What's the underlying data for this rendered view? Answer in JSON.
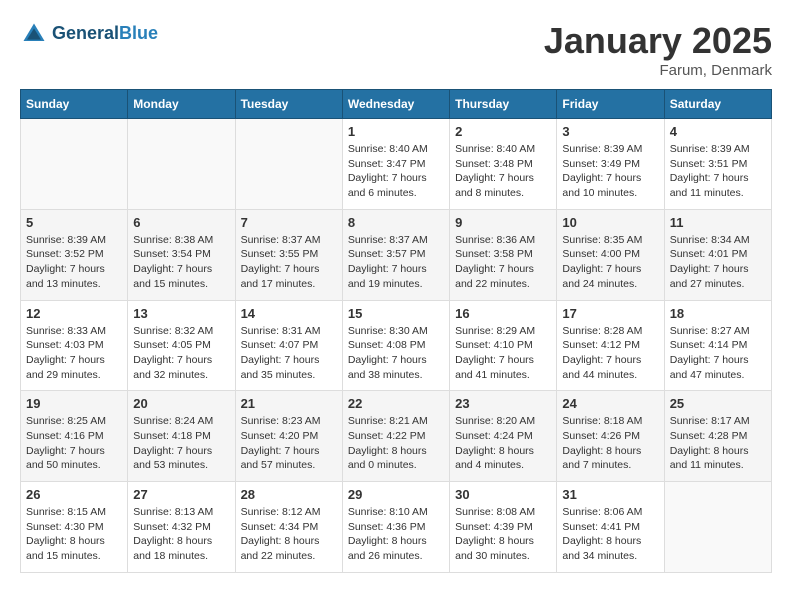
{
  "header": {
    "logo_line1": "General",
    "logo_line2": "Blue",
    "month": "January 2025",
    "location": "Farum, Denmark"
  },
  "weekdays": [
    "Sunday",
    "Monday",
    "Tuesday",
    "Wednesday",
    "Thursday",
    "Friday",
    "Saturday"
  ],
  "weeks": [
    [
      {
        "day": "",
        "info": ""
      },
      {
        "day": "",
        "info": ""
      },
      {
        "day": "",
        "info": ""
      },
      {
        "day": "1",
        "info": "Sunrise: 8:40 AM\nSunset: 3:47 PM\nDaylight: 7 hours\nand 6 minutes."
      },
      {
        "day": "2",
        "info": "Sunrise: 8:40 AM\nSunset: 3:48 PM\nDaylight: 7 hours\nand 8 minutes."
      },
      {
        "day": "3",
        "info": "Sunrise: 8:39 AM\nSunset: 3:49 PM\nDaylight: 7 hours\nand 10 minutes."
      },
      {
        "day": "4",
        "info": "Sunrise: 8:39 AM\nSunset: 3:51 PM\nDaylight: 7 hours\nand 11 minutes."
      }
    ],
    [
      {
        "day": "5",
        "info": "Sunrise: 8:39 AM\nSunset: 3:52 PM\nDaylight: 7 hours\nand 13 minutes."
      },
      {
        "day": "6",
        "info": "Sunrise: 8:38 AM\nSunset: 3:54 PM\nDaylight: 7 hours\nand 15 minutes."
      },
      {
        "day": "7",
        "info": "Sunrise: 8:37 AM\nSunset: 3:55 PM\nDaylight: 7 hours\nand 17 minutes."
      },
      {
        "day": "8",
        "info": "Sunrise: 8:37 AM\nSunset: 3:57 PM\nDaylight: 7 hours\nand 19 minutes."
      },
      {
        "day": "9",
        "info": "Sunrise: 8:36 AM\nSunset: 3:58 PM\nDaylight: 7 hours\nand 22 minutes."
      },
      {
        "day": "10",
        "info": "Sunrise: 8:35 AM\nSunset: 4:00 PM\nDaylight: 7 hours\nand 24 minutes."
      },
      {
        "day": "11",
        "info": "Sunrise: 8:34 AM\nSunset: 4:01 PM\nDaylight: 7 hours\nand 27 minutes."
      }
    ],
    [
      {
        "day": "12",
        "info": "Sunrise: 8:33 AM\nSunset: 4:03 PM\nDaylight: 7 hours\nand 29 minutes."
      },
      {
        "day": "13",
        "info": "Sunrise: 8:32 AM\nSunset: 4:05 PM\nDaylight: 7 hours\nand 32 minutes."
      },
      {
        "day": "14",
        "info": "Sunrise: 8:31 AM\nSunset: 4:07 PM\nDaylight: 7 hours\nand 35 minutes."
      },
      {
        "day": "15",
        "info": "Sunrise: 8:30 AM\nSunset: 4:08 PM\nDaylight: 7 hours\nand 38 minutes."
      },
      {
        "day": "16",
        "info": "Sunrise: 8:29 AM\nSunset: 4:10 PM\nDaylight: 7 hours\nand 41 minutes."
      },
      {
        "day": "17",
        "info": "Sunrise: 8:28 AM\nSunset: 4:12 PM\nDaylight: 7 hours\nand 44 minutes."
      },
      {
        "day": "18",
        "info": "Sunrise: 8:27 AM\nSunset: 4:14 PM\nDaylight: 7 hours\nand 47 minutes."
      }
    ],
    [
      {
        "day": "19",
        "info": "Sunrise: 8:25 AM\nSunset: 4:16 PM\nDaylight: 7 hours\nand 50 minutes."
      },
      {
        "day": "20",
        "info": "Sunrise: 8:24 AM\nSunset: 4:18 PM\nDaylight: 7 hours\nand 53 minutes."
      },
      {
        "day": "21",
        "info": "Sunrise: 8:23 AM\nSunset: 4:20 PM\nDaylight: 7 hours\nand 57 minutes."
      },
      {
        "day": "22",
        "info": "Sunrise: 8:21 AM\nSunset: 4:22 PM\nDaylight: 8 hours\nand 0 minutes."
      },
      {
        "day": "23",
        "info": "Sunrise: 8:20 AM\nSunset: 4:24 PM\nDaylight: 8 hours\nand 4 minutes."
      },
      {
        "day": "24",
        "info": "Sunrise: 8:18 AM\nSunset: 4:26 PM\nDaylight: 8 hours\nand 7 minutes."
      },
      {
        "day": "25",
        "info": "Sunrise: 8:17 AM\nSunset: 4:28 PM\nDaylight: 8 hours\nand 11 minutes."
      }
    ],
    [
      {
        "day": "26",
        "info": "Sunrise: 8:15 AM\nSunset: 4:30 PM\nDaylight: 8 hours\nand 15 minutes."
      },
      {
        "day": "27",
        "info": "Sunrise: 8:13 AM\nSunset: 4:32 PM\nDaylight: 8 hours\nand 18 minutes."
      },
      {
        "day": "28",
        "info": "Sunrise: 8:12 AM\nSunset: 4:34 PM\nDaylight: 8 hours\nand 22 minutes."
      },
      {
        "day": "29",
        "info": "Sunrise: 8:10 AM\nSunset: 4:36 PM\nDaylight: 8 hours\nand 26 minutes."
      },
      {
        "day": "30",
        "info": "Sunrise: 8:08 AM\nSunset: 4:39 PM\nDaylight: 8 hours\nand 30 minutes."
      },
      {
        "day": "31",
        "info": "Sunrise: 8:06 AM\nSunset: 4:41 PM\nDaylight: 8 hours\nand 34 minutes."
      },
      {
        "day": "",
        "info": ""
      }
    ]
  ]
}
